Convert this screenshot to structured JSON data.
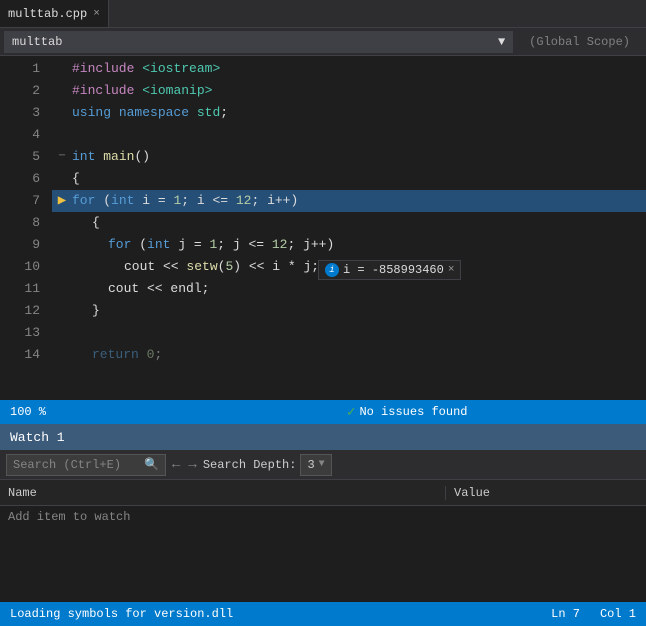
{
  "tab": {
    "filename": "multtab.cpp",
    "close_label": "×"
  },
  "toolbar": {
    "file_name": "multtab",
    "dropdown_arrow": "▼",
    "scope": "(Global Scope)"
  },
  "code": {
    "lines": [
      {
        "num": "1",
        "indent": "",
        "content": "#include <iostream>",
        "type": "include"
      },
      {
        "num": "2",
        "indent": "",
        "content": "#include <iomanip>",
        "type": "include"
      },
      {
        "num": "3",
        "indent": "",
        "content": "using namespace std;",
        "type": "using"
      },
      {
        "num": "4",
        "indent": "",
        "content": "",
        "type": "empty"
      },
      {
        "num": "5",
        "indent": "",
        "content": "int main()",
        "type": "fn_decl",
        "has_collapse": true
      },
      {
        "num": "6",
        "indent": "",
        "content": "{",
        "type": "brace"
      },
      {
        "num": "7",
        "indent": "    ",
        "content": "for (int i = 1; i <= 12; i++)",
        "type": "for",
        "has_arrow": true,
        "has_collapse": true
      },
      {
        "num": "8",
        "indent": "    ",
        "content": "{",
        "type": "brace"
      },
      {
        "num": "9",
        "indent": "        ",
        "content": "for (int j = 1; j <= 12; j++)",
        "type": "for"
      },
      {
        "num": "10",
        "indent": "            ",
        "content": "cout << setw(5) << i * j;",
        "type": "cout"
      },
      {
        "num": "11",
        "indent": "        ",
        "content": "cout << endl;",
        "type": "cout"
      },
      {
        "num": "12",
        "indent": "    ",
        "content": "}",
        "type": "brace"
      },
      {
        "num": "13",
        "indent": "",
        "content": "",
        "type": "empty"
      },
      {
        "num": "14",
        "indent": "    ",
        "content": "return 0;",
        "type": "return",
        "partial": true
      }
    ]
  },
  "tooltip": {
    "icon_label": "i",
    "var_name": "i",
    "var_value": "-858993460",
    "close": "×"
  },
  "editor_status": {
    "zoom": "100 %",
    "check": "✓",
    "issues": "No issues found"
  },
  "watch": {
    "title": "Watch 1",
    "search_placeholder": "Search (Ctrl+E)",
    "search_icon": "🔍",
    "nav_back": "←",
    "nav_fwd": "→",
    "depth_label": "Search Depth:",
    "depth_value": "3",
    "depth_arrow": "▼",
    "col_name": "Name",
    "col_value": "Value",
    "add_item": "Add item to watch"
  },
  "bottom_status": {
    "loading": "Loading symbols for version.dll",
    "ln_label": "Ln 7",
    "col_label": "Col 1"
  }
}
